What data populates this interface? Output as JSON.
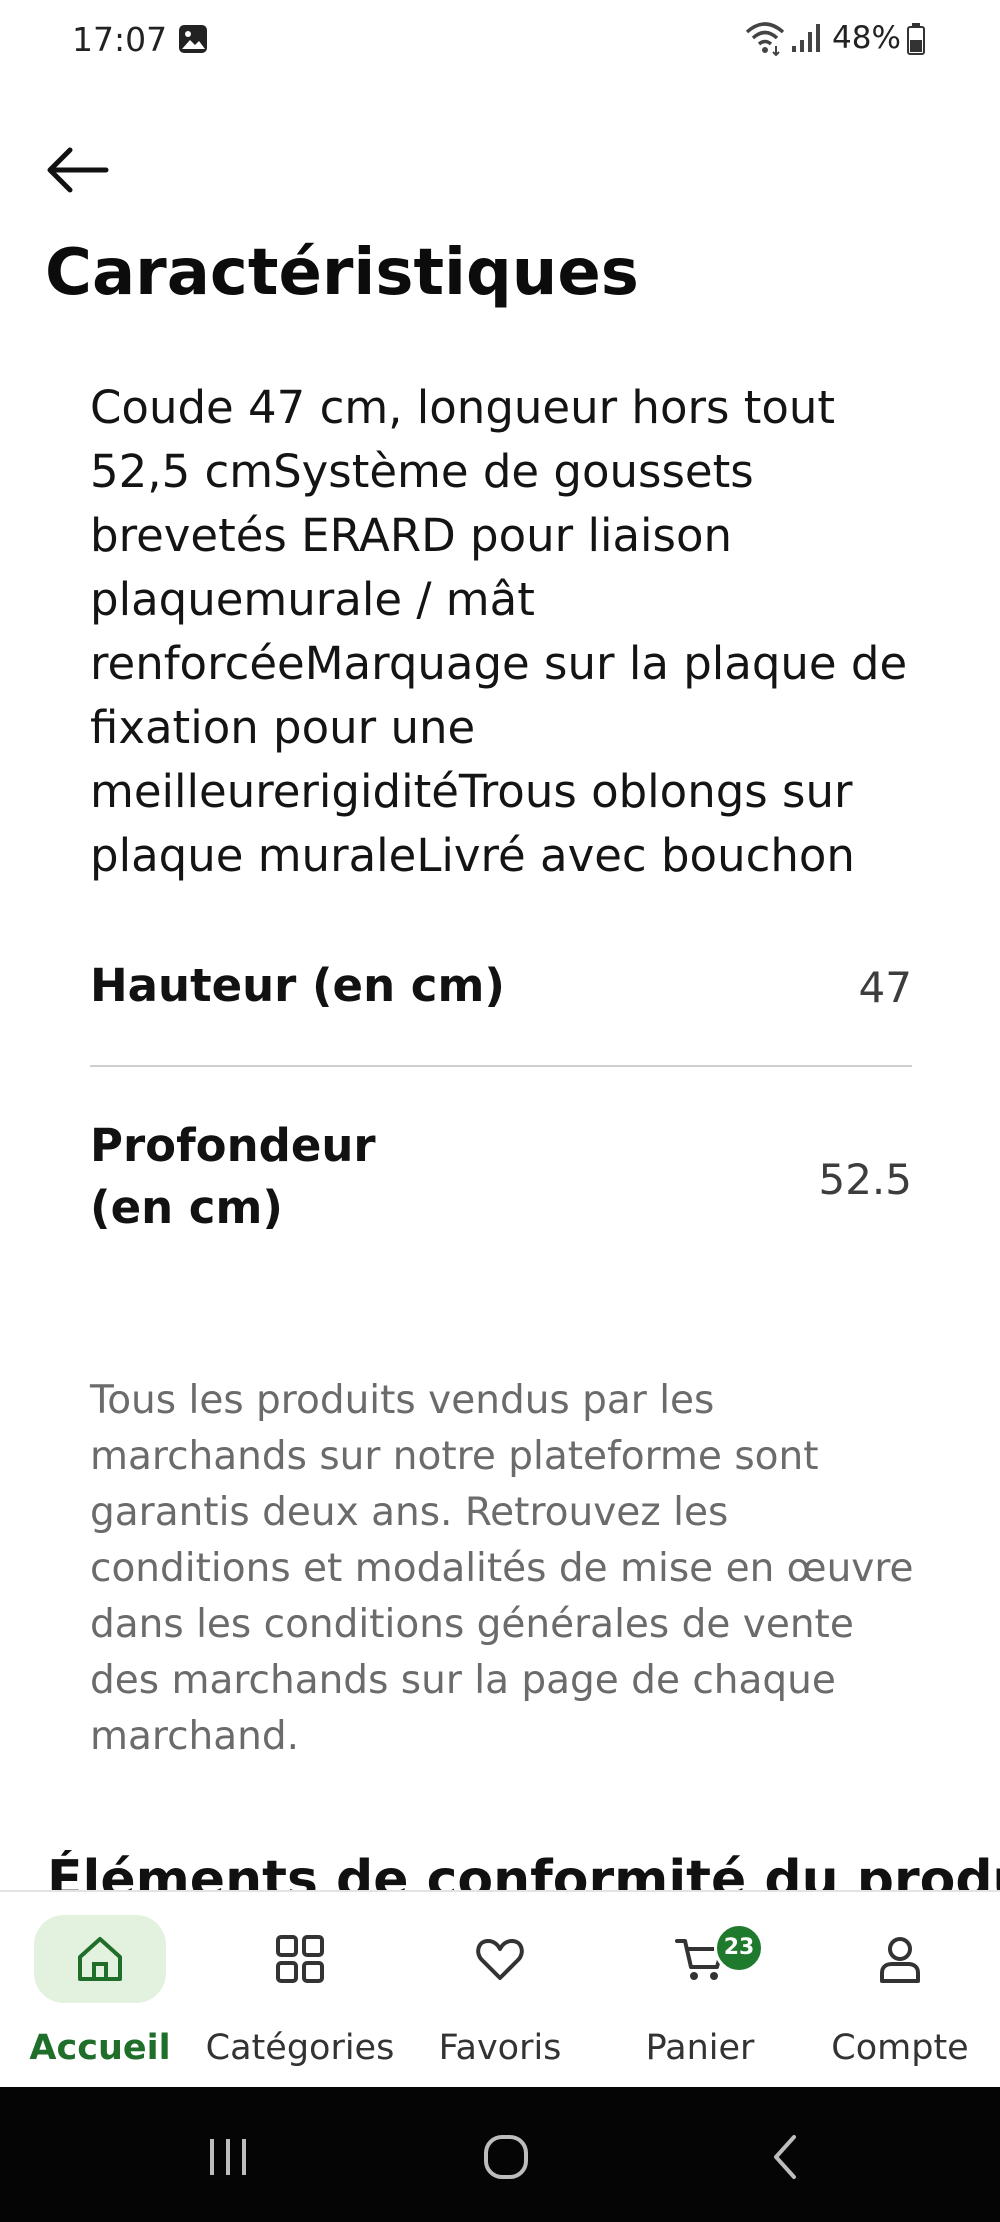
{
  "status_bar": {
    "time": "17:07",
    "battery": "48%",
    "icons": [
      "gallery-icon",
      "wifi-icon",
      "signal-icon",
      "battery-icon"
    ]
  },
  "header": {
    "back_icon": "arrow-left-icon",
    "title": "Caractéristiques"
  },
  "description": "Coude 47 cm, longueur hors tout 52,5 cmSystème de goussets brevetés ERARD pour liaison plaquemurale / mât renforcéeMarquage sur la plaque de fixation pour une meilleurerigiditéTrous oblongs sur plaque muraleLivré avec bouchon",
  "specs": [
    {
      "label": "Hauteur (en cm)",
      "value": "47"
    },
    {
      "label": "Profondeur (en cm)",
      "value": "52.5"
    }
  ],
  "warranty_text": "Tous les produits vendus par les marchands sur notre plateforme sont garantis deux ans. Retrouvez les conditions et modalités de mise en œuvre dans les conditions générales de vente des marchands sur la page de chaque marchand.",
  "next_section_heading": "Éléments de conformité du produit",
  "bottom_nav": {
    "items": [
      {
        "label": "Accueil",
        "icon": "home-icon",
        "active": true
      },
      {
        "label": "Catégories",
        "icon": "grid-icon",
        "active": false
      },
      {
        "label": "Favoris",
        "icon": "heart-icon",
        "active": false
      },
      {
        "label": "Panier",
        "icon": "cart-icon",
        "active": false,
        "badge": "23"
      },
      {
        "label": "Compte",
        "icon": "user-icon",
        "active": false
      }
    ]
  },
  "system_nav": {
    "icons": [
      "recent-apps-icon",
      "home-circle-icon",
      "back-chevron-icon"
    ]
  },
  "colors": {
    "accent": "#1f6f2b",
    "active_bg": "#e3f1df",
    "badge": "#1f7a2e",
    "muted_text": "#6b6b6b"
  }
}
